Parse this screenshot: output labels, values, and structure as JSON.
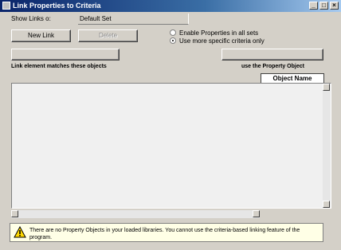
{
  "window": {
    "title": "Link Properties to Criteria",
    "icons": {
      "app": "app-icon",
      "minimize": "minimize-icon",
      "maximize": "maximize-icon",
      "close": "close-icon"
    }
  },
  "selection": {
    "label": "Show Links o:",
    "value": "Default Set"
  },
  "buttons": {
    "new_link": "New Link",
    "second": "Delete",
    "left_wide": "",
    "right_wide": ""
  },
  "options": {
    "opt1": "Enable Properties in all sets",
    "opt2": "Use more specific criteria only",
    "selected": "opt2"
  },
  "captions": {
    "left": "Link element matches these objects",
    "right": "use the Property Object"
  },
  "tab_label": "Object Name",
  "warning": {
    "icon": "warning-icon",
    "text": "There are no Property Objects in your loaded libraries. You cannot use the criteria-based linking feature of the program."
  },
  "colors": {
    "title_start": "#0a246a",
    "title_end": "#a6caf0",
    "dialog": "#d4d0c8",
    "warning_bg": "#ffffe6"
  }
}
